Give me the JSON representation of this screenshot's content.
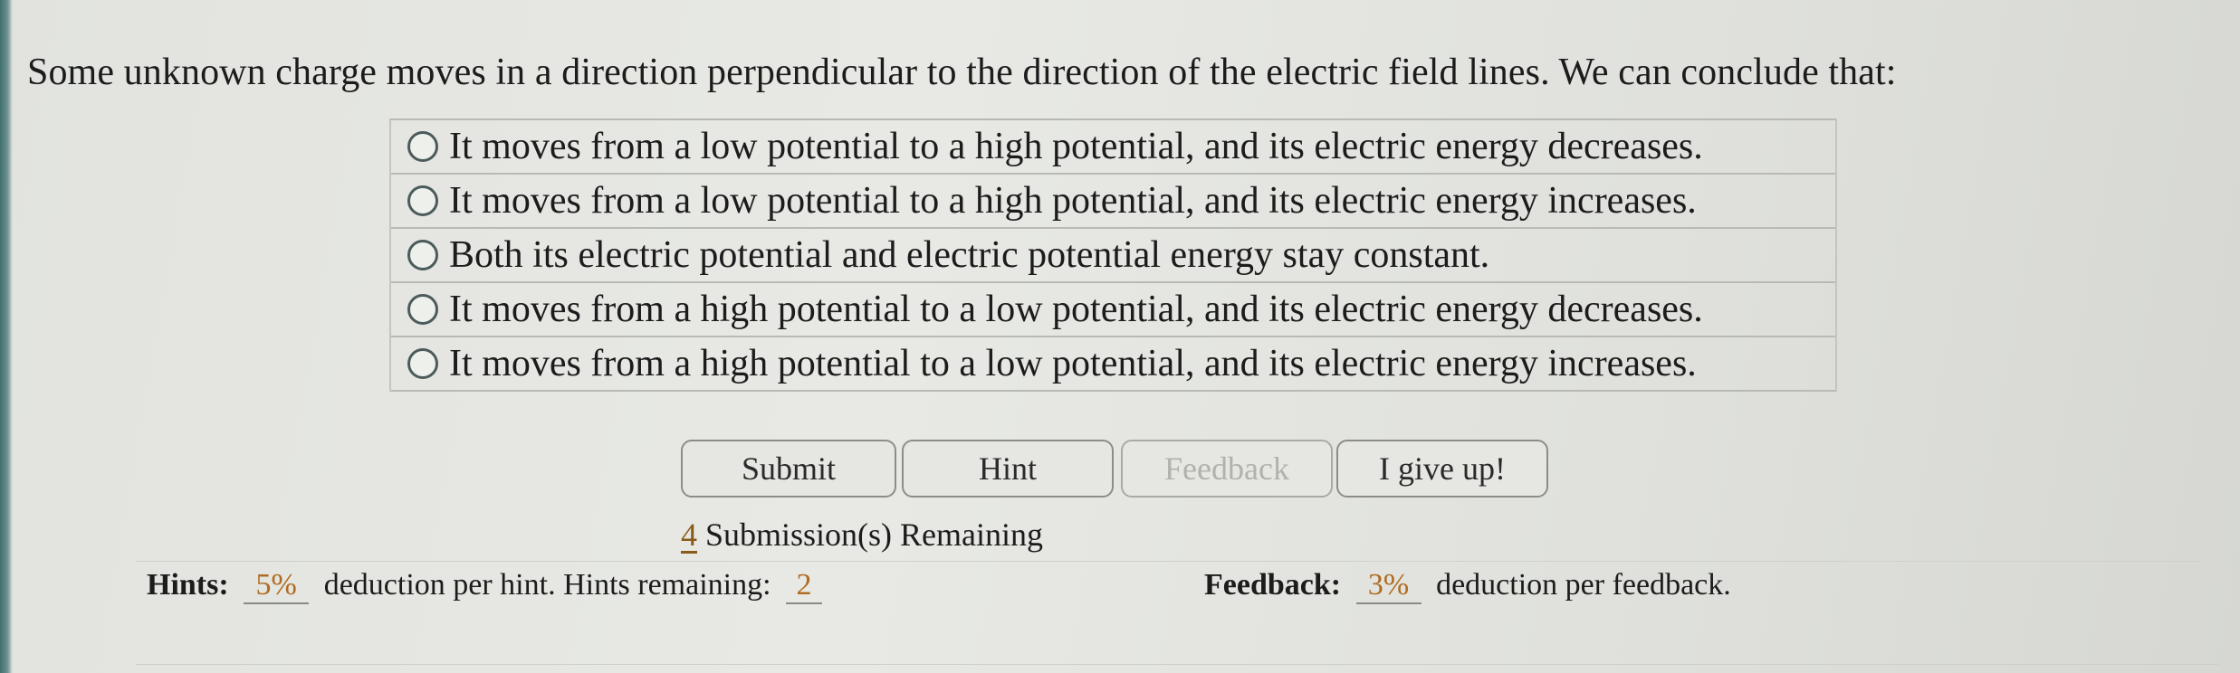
{
  "question": {
    "prompt": "Some unknown charge moves in a direction perpendicular to the direction of the electric field lines. We can conclude that:",
    "options": [
      "It moves from a low potential to a high potential, and its electric energy decreases.",
      "It moves from a low potential to a high potential, and its electric energy increases.",
      "Both its electric potential and electric potential energy stay constant.",
      "It moves from a high potential to a low potential, and its electric energy decreases.",
      "It moves from a high potential to a low potential, and its electric energy increases."
    ]
  },
  "buttons": {
    "submit": "Submit",
    "hint": "Hint",
    "feedback": "Feedback",
    "give_up": "I give up!"
  },
  "submissions": {
    "count": "4",
    "label": "Submission(s) Remaining"
  },
  "hints": {
    "label": "Hints:",
    "deduction": "5%",
    "deduction_text": "deduction per hint. Hints remaining:",
    "remaining": "2"
  },
  "feedback_info": {
    "label": "Feedback:",
    "deduction": "3%",
    "deduction_text": "deduction per feedback."
  }
}
